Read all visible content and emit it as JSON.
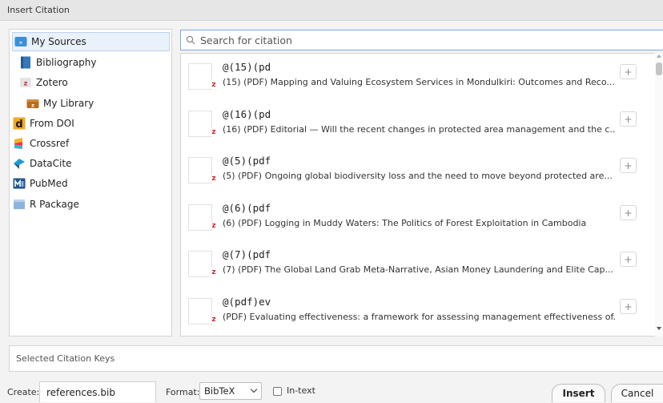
{
  "window": {
    "title": "Insert Citation"
  },
  "sources": [
    {
      "label": "My Sources",
      "icon": "folder-link-icon",
      "indent": 0,
      "selected": true
    },
    {
      "label": "Bibliography",
      "icon": "book-icon",
      "indent": 1
    },
    {
      "label": "Zotero",
      "icon": "zotero-icon",
      "indent": 1
    },
    {
      "label": "My Library",
      "icon": "library-icon",
      "indent": 2
    },
    {
      "label": "From DOI",
      "icon": "doi-icon",
      "indent": 0
    },
    {
      "label": "Crossref",
      "icon": "crossref-icon",
      "indent": 0
    },
    {
      "label": "DataCite",
      "icon": "datacite-icon",
      "indent": 0
    },
    {
      "label": "PubMed",
      "icon": "pubmed-icon",
      "indent": 0
    },
    {
      "label": "R Package",
      "icon": "package-icon",
      "indent": 0
    }
  ],
  "search": {
    "placeholder": "Search for citation",
    "value": ""
  },
  "citations": [
    {
      "key": "@(15)(pd",
      "title": "(15) (PDF) Mapping and Valuing Ecosystem Services in Mondulkiri: Outcomes and Reco..."
    },
    {
      "key": "@(16)(pd",
      "title": "(16) (PDF) Editorial — Will the recent changes in protected area management and the c..."
    },
    {
      "key": "@(5)(pdf",
      "title": "(5) (PDF) Ongoing global biodiversity loss and the need to move beyond protected are..."
    },
    {
      "key": "@(6)(pdf",
      "title": "(6) (PDF) Logging in Muddy Waters: The Politics of Forest Exploitation in Cambodia"
    },
    {
      "key": "@(7)(pdf",
      "title": "(7) (PDF) The Global Land Grab Meta-Narrative, Asian Money Laundering and Elite Cap..."
    },
    {
      "key": "@(pdf)ev",
      "title": "(PDF) Evaluating effectiveness: a framework for assessing management effectiveness of..."
    }
  ],
  "row_badge": "z",
  "add_label": "+",
  "selected_keys": {
    "placeholder": "Selected Citation Keys"
  },
  "bottom": {
    "create_label": "Create:",
    "create_value": "references.bib",
    "format_label": "Format:",
    "format_value": "BibTeX",
    "intext_label": "In-text",
    "insert_label": "Insert",
    "cancel_label": "Cancel"
  },
  "colors": {
    "accent": "#7aa7e0",
    "zotero_red": "#cc2936",
    "selection": "#e9f1fb"
  }
}
